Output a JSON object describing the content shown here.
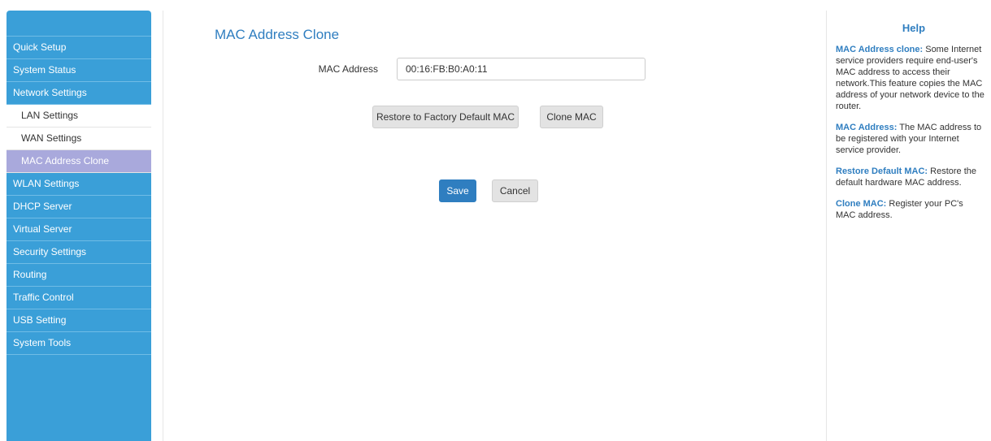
{
  "sidebar": {
    "items": [
      {
        "label": "Quick Setup"
      },
      {
        "label": "System Status"
      },
      {
        "label": "Network Settings"
      },
      {
        "label": "LAN Settings"
      },
      {
        "label": "WAN Settings"
      },
      {
        "label": "MAC Address Clone"
      },
      {
        "label": "WLAN Settings"
      },
      {
        "label": "DHCP Server"
      },
      {
        "label": "Virtual Server"
      },
      {
        "label": "Security Settings"
      },
      {
        "label": "Routing"
      },
      {
        "label": "Traffic Control"
      },
      {
        "label": "USB Setting"
      },
      {
        "label": "System Tools"
      }
    ],
    "active_item": "MAC Address Clone"
  },
  "main": {
    "title": "MAC Address Clone",
    "mac_label": "MAC Address",
    "mac_value": "00:16:FB:B0:A0:11",
    "restore_button": "Restore to Factory Default MAC",
    "clone_button": "Clone MAC",
    "save_button": "Save",
    "cancel_button": "Cancel"
  },
  "help": {
    "title": "Help",
    "items": [
      {
        "term": "MAC Address clone:",
        "text": " Some Internet service providers require end-user's MAC address to access their network.This feature copies the MAC address of your network device to the router."
      },
      {
        "term": "MAC Address:",
        "text": " The MAC address to be registered with your Internet service provider."
      },
      {
        "term": "Restore Default MAC:",
        "text": " Restore the default hardware MAC address."
      },
      {
        "term": "Clone MAC:",
        "text": " Register your PC's MAC address."
      }
    ]
  },
  "colors": {
    "sidebar_bg": "#3a9fd8",
    "active_item_bg": "#a9a9dc",
    "accent": "#2f7ec0"
  }
}
